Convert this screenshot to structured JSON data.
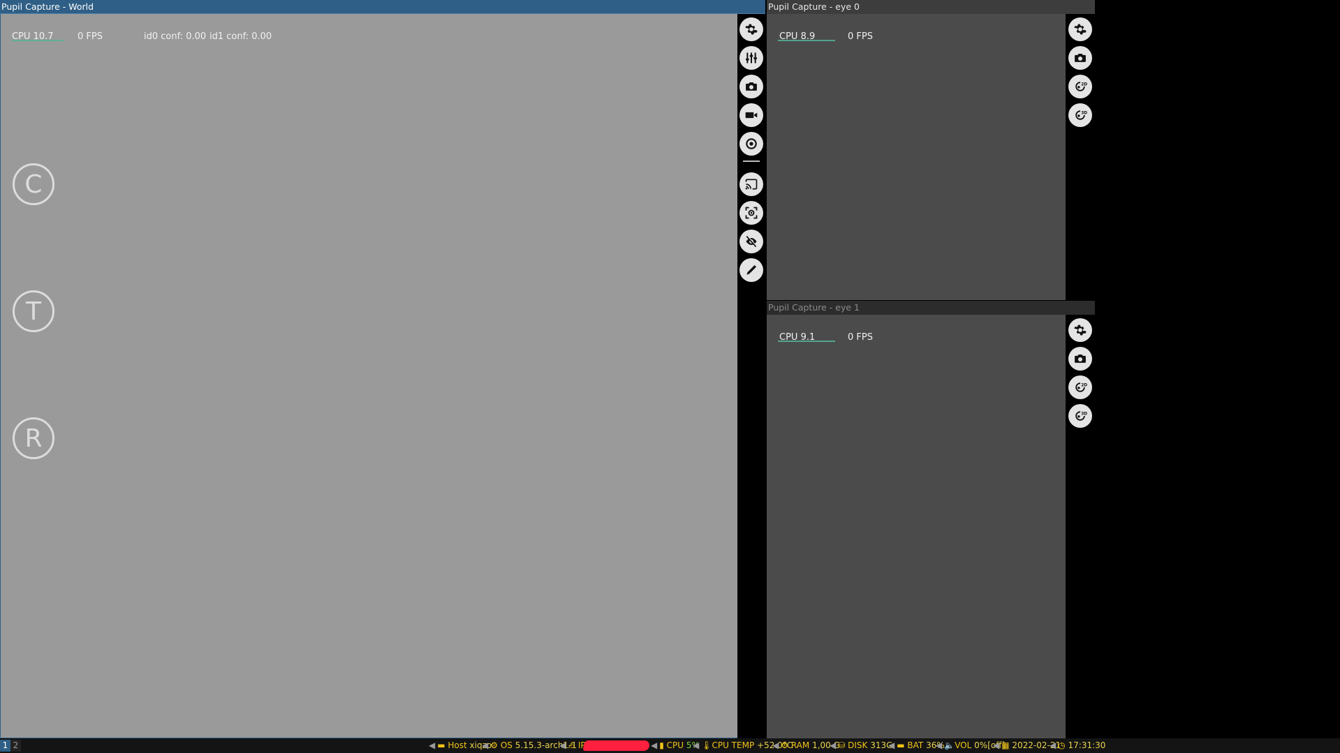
{
  "world": {
    "title": "Pupil Capture - World",
    "cpu": "CPU 10.7",
    "fps": "0 FPS",
    "id0_conf": "id0 conf: 0.00",
    "id1_conf": "id1 conf: 0.00",
    "letter_buttons": [
      "C",
      "T",
      "R"
    ]
  },
  "eye0": {
    "title": "Pupil Capture - eye 0",
    "cpu": "CPU 8.9",
    "fps": "0 FPS"
  },
  "eye1": {
    "title": "Pupil Capture - eye 1",
    "cpu": "CPU 9.1",
    "fps": "0 FPS"
  },
  "statusbar": {
    "workspaces": [
      "1",
      "2"
    ],
    "host_label": "Host",
    "host_value": "xiqzo",
    "os_label": "OS",
    "os_value": "5.15.3-arch1-1",
    "ip_label": "IP",
    "cpu_label": "CPU",
    "cpu_value": "5%",
    "temp_label": "CPU TEMP",
    "temp_value": "+52.0°C",
    "ram_label": "RAM",
    "ram_value": "1,00 G",
    "disk_label": "DISK",
    "disk_value": "313G",
    "bat_label": "BAT",
    "bat_value": "36%",
    "vol_label": "VOL",
    "vol_value": "0%[off]",
    "date": "2022-02-21",
    "time": "17:31:30"
  },
  "colors": {
    "accent_titlebar": "#2f5f86",
    "world_canvas": "#9a9a9a",
    "eye_canvas": "#4b4b4b",
    "graph": "#56b39a",
    "status_text": "#f0c419",
    "redacted": "#ff2040"
  }
}
